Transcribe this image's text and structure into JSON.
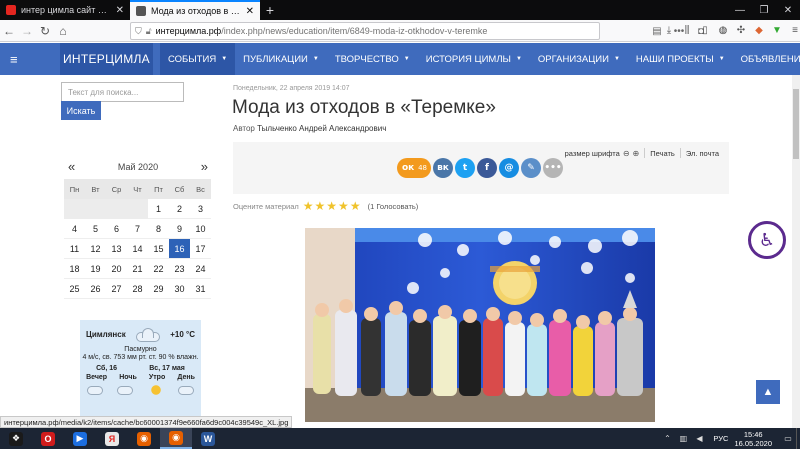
{
  "browser": {
    "tabs": [
      {
        "title": "интер цимла сайт — Яндекс:",
        "active": false
      },
      {
        "title": "Мода из отходов в «Теремке»",
        "active": true
      }
    ],
    "new_tab": "+",
    "url_host": "интерцимла.рф",
    "url_path": "/index.php/news/education/item/6849-moda-iz-otkhodov-v-teremke",
    "status_url": "интерцимла.рф/media/k2/items/cache/bc60001374f9e660fa6d9c004c39549c_XL.jpg"
  },
  "site": {
    "logo": "ИНТЕРЦИМЛА",
    "menu": [
      {
        "label": "СОБЫТИЯ",
        "caret": true
      },
      {
        "label": "ПУБЛИКАЦИИ",
        "caret": true
      },
      {
        "label": "ТВОРЧЕСТВО",
        "caret": true
      },
      {
        "label": "ИСТОРИЯ ЦИМЛЫ",
        "caret": true
      },
      {
        "label": "ОРГАНИЗАЦИИ",
        "caret": true
      },
      {
        "label": "НАШИ ПРОЕКТЫ",
        "caret": true
      },
      {
        "label": "ОБЪЯВЛЕНИЯ",
        "caret": false
      }
    ],
    "search_placeholder": "Текст для поиска...",
    "search_button": "Искать"
  },
  "calendar": {
    "month": "Май 2020",
    "prev": "«",
    "next": "»",
    "weekdays": [
      "Пн",
      "Вт",
      "Ср",
      "Чт",
      "Пт",
      "Сб",
      "Вс"
    ],
    "leading_blank": 4,
    "days": 31,
    "today": 16
  },
  "weather": {
    "city": "Цимлянск",
    "temp": "+10 °C",
    "condition": "Пасмурно",
    "details": "4 м/с, св.  753 мм рт. ст.  90 % влажн.",
    "days": [
      "Сб, 16",
      "Вс, 17 мая"
    ],
    "periods": [
      "Вечер",
      "Ночь",
      "Утро",
      "День"
    ],
    "period_icons": [
      "cloud-icon",
      "cloud-icon",
      "sun-icon",
      "cloud-icon"
    ]
  },
  "article": {
    "date": "Понедельник, 22 апреля 2019 14:07",
    "title": "Мода из отходов в «Теремке»",
    "author_label": "Автор",
    "author": "Тыльченко Андрей Александрович",
    "font_size_label": "размер шрифта",
    "print": "Печать",
    "email": "Эл. почта",
    "rating_label": "Оцените материал",
    "rating_stars": 5,
    "votes": "(1 Голосовать)",
    "ok_count": "48"
  },
  "socials": [
    {
      "name": "odnoklassniki",
      "glyph": "ок",
      "color": "#f39a1d"
    },
    {
      "name": "vkontakte",
      "glyph": "вк",
      "color": "#4a76a8"
    },
    {
      "name": "twitter",
      "glyph": "t",
      "color": "#1da1f2"
    },
    {
      "name": "facebook",
      "glyph": "f",
      "color": "#3b5998"
    },
    {
      "name": "mail",
      "glyph": "@",
      "color": "#168de2"
    },
    {
      "name": "livejournal",
      "glyph": "✎",
      "color": "#5b8fc9"
    },
    {
      "name": "more",
      "glyph": "•••",
      "color": "#b5b5b5"
    }
  ],
  "taskbar": {
    "apps": [
      {
        "name": "start",
        "color": "#1a1a1a",
        "glyph": "❖"
      },
      {
        "name": "opera",
        "color": "#d01c1c",
        "glyph": "O"
      },
      {
        "name": "media-player",
        "color": "#1c6ee0",
        "glyph": "▶"
      },
      {
        "name": "yandex-browser",
        "color": "#e8e8e8",
        "glyph": "Я"
      },
      {
        "name": "firefox",
        "color": "#e66000",
        "glyph": "◉"
      },
      {
        "name": "firefox-active",
        "color": "#e66000",
        "glyph": "◉"
      },
      {
        "name": "word",
        "color": "#2b579a",
        "glyph": "W"
      }
    ],
    "lang": "РУС",
    "time": "15:46",
    "date": "16.05.2020"
  }
}
